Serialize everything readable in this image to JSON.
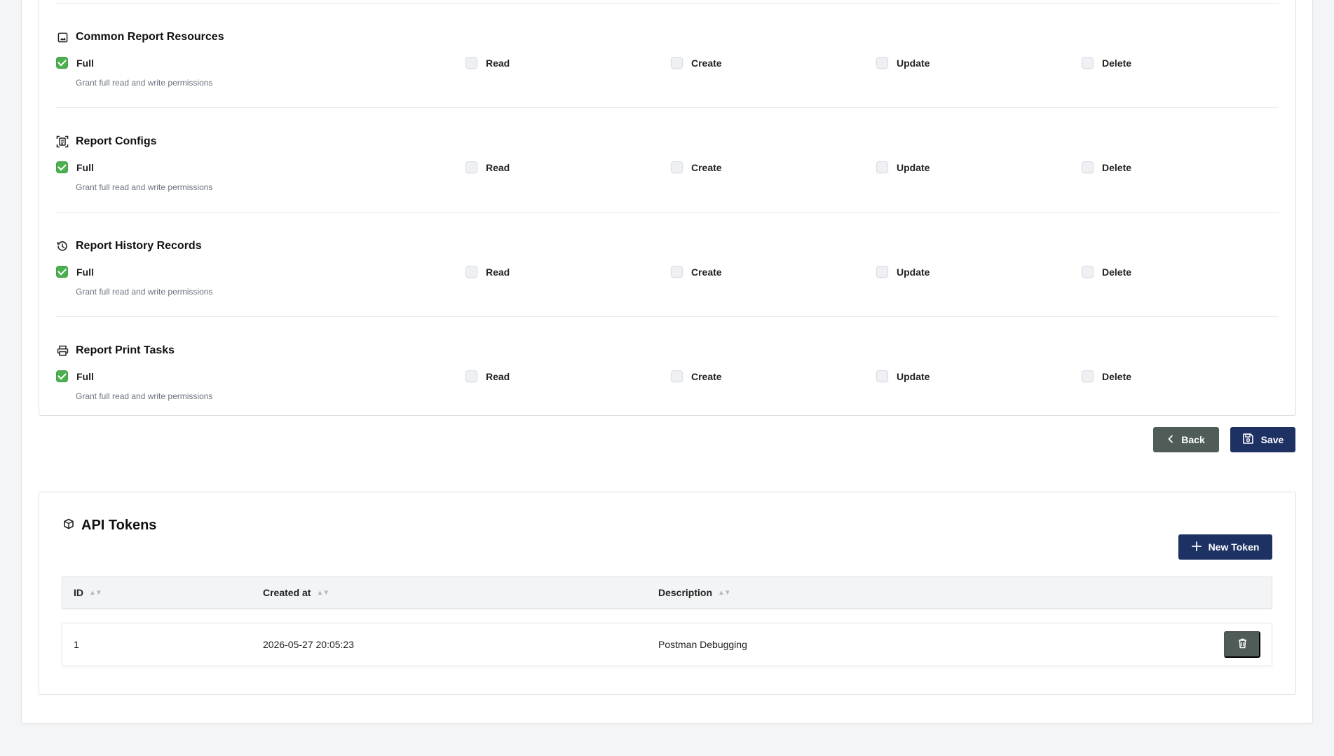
{
  "permission_labels": {
    "full": "Full",
    "read": "Read",
    "create": "Create",
    "update": "Update",
    "delete": "Delete",
    "full_description": "Grant full read and write permissions"
  },
  "sections": [
    {
      "title": "Common Report Resources",
      "icon": "image-icon",
      "full_checked": true
    },
    {
      "title": "Report Configs",
      "icon": "document-scan-icon",
      "full_checked": true
    },
    {
      "title": "Report History Records",
      "icon": "history-icon",
      "full_checked": true
    },
    {
      "title": "Report Print Tasks",
      "icon": "printer-icon",
      "full_checked": true
    }
  ],
  "actions": {
    "back_label": "Back",
    "save_label": "Save"
  },
  "tokens": {
    "title": "API Tokens",
    "new_token_label": "New Token",
    "columns": {
      "id": "ID",
      "created_at": "Created at",
      "description": "Description"
    },
    "rows": [
      {
        "id": "1",
        "created_at": "2026-05-27 20:05:23",
        "description": "Postman Debugging"
      }
    ]
  },
  "colors": {
    "primary": "#1e3163",
    "secondary": "#4f5c57",
    "check": "#4caf50"
  }
}
